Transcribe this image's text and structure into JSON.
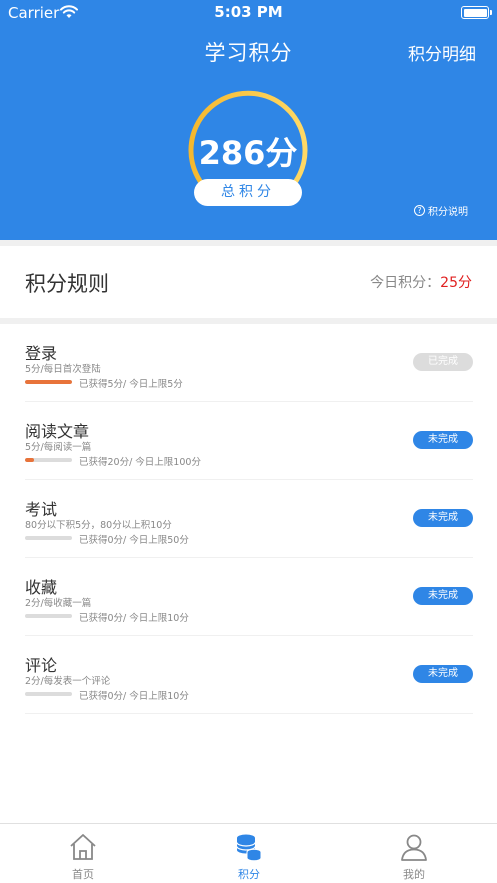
{
  "status_bar": {
    "carrier": "Carrier",
    "time": "5:03 PM"
  },
  "header": {
    "title": "学习积分",
    "detail_link": "积分明细",
    "score": "286分",
    "total_label": "总积分",
    "explain_label": "积分说明",
    "colors": {
      "background": "#2f86e6",
      "gauge_gradient_start": "#f7c342",
      "gauge_gradient_end": "#ffd966"
    }
  },
  "rules": {
    "title": "积分规则",
    "today_label": "今日积分：",
    "today_value": "25分"
  },
  "tasks": [
    {
      "name": "登录",
      "desc": "5分/每日首次登陆",
      "progress_text": "已获得5分/ 今日上限5分",
      "progress": 1.0,
      "status": "已完成",
      "done": true
    },
    {
      "name": "阅读文章",
      "desc": "5分/每阅读一篇",
      "progress_text": "已获得20分/ 今日上限100分",
      "progress": 0.2,
      "status": "未完成",
      "done": false
    },
    {
      "name": "考试",
      "desc": "80分以下积5分，80分以上积10分",
      "progress_text": "已获得0分/ 今日上限50分",
      "progress": 0,
      "status": "未完成",
      "done": false
    },
    {
      "name": "收藏",
      "desc": "2分/每收藏一篇",
      "progress_text": "已获得0分/ 今日上限10分",
      "progress": 0,
      "status": "未完成",
      "done": false
    },
    {
      "name": "评论",
      "desc": "2分/每发表一个评论",
      "progress_text": "已获得0分/ 今日上限10分",
      "progress": 0,
      "status": "未完成",
      "done": false
    }
  ],
  "tabbar": {
    "items": [
      {
        "label": "首页",
        "icon": "home-icon",
        "active": false
      },
      {
        "label": "积分",
        "icon": "coins-icon",
        "active": true
      },
      {
        "label": "我的",
        "icon": "user-icon",
        "active": false
      }
    ]
  }
}
